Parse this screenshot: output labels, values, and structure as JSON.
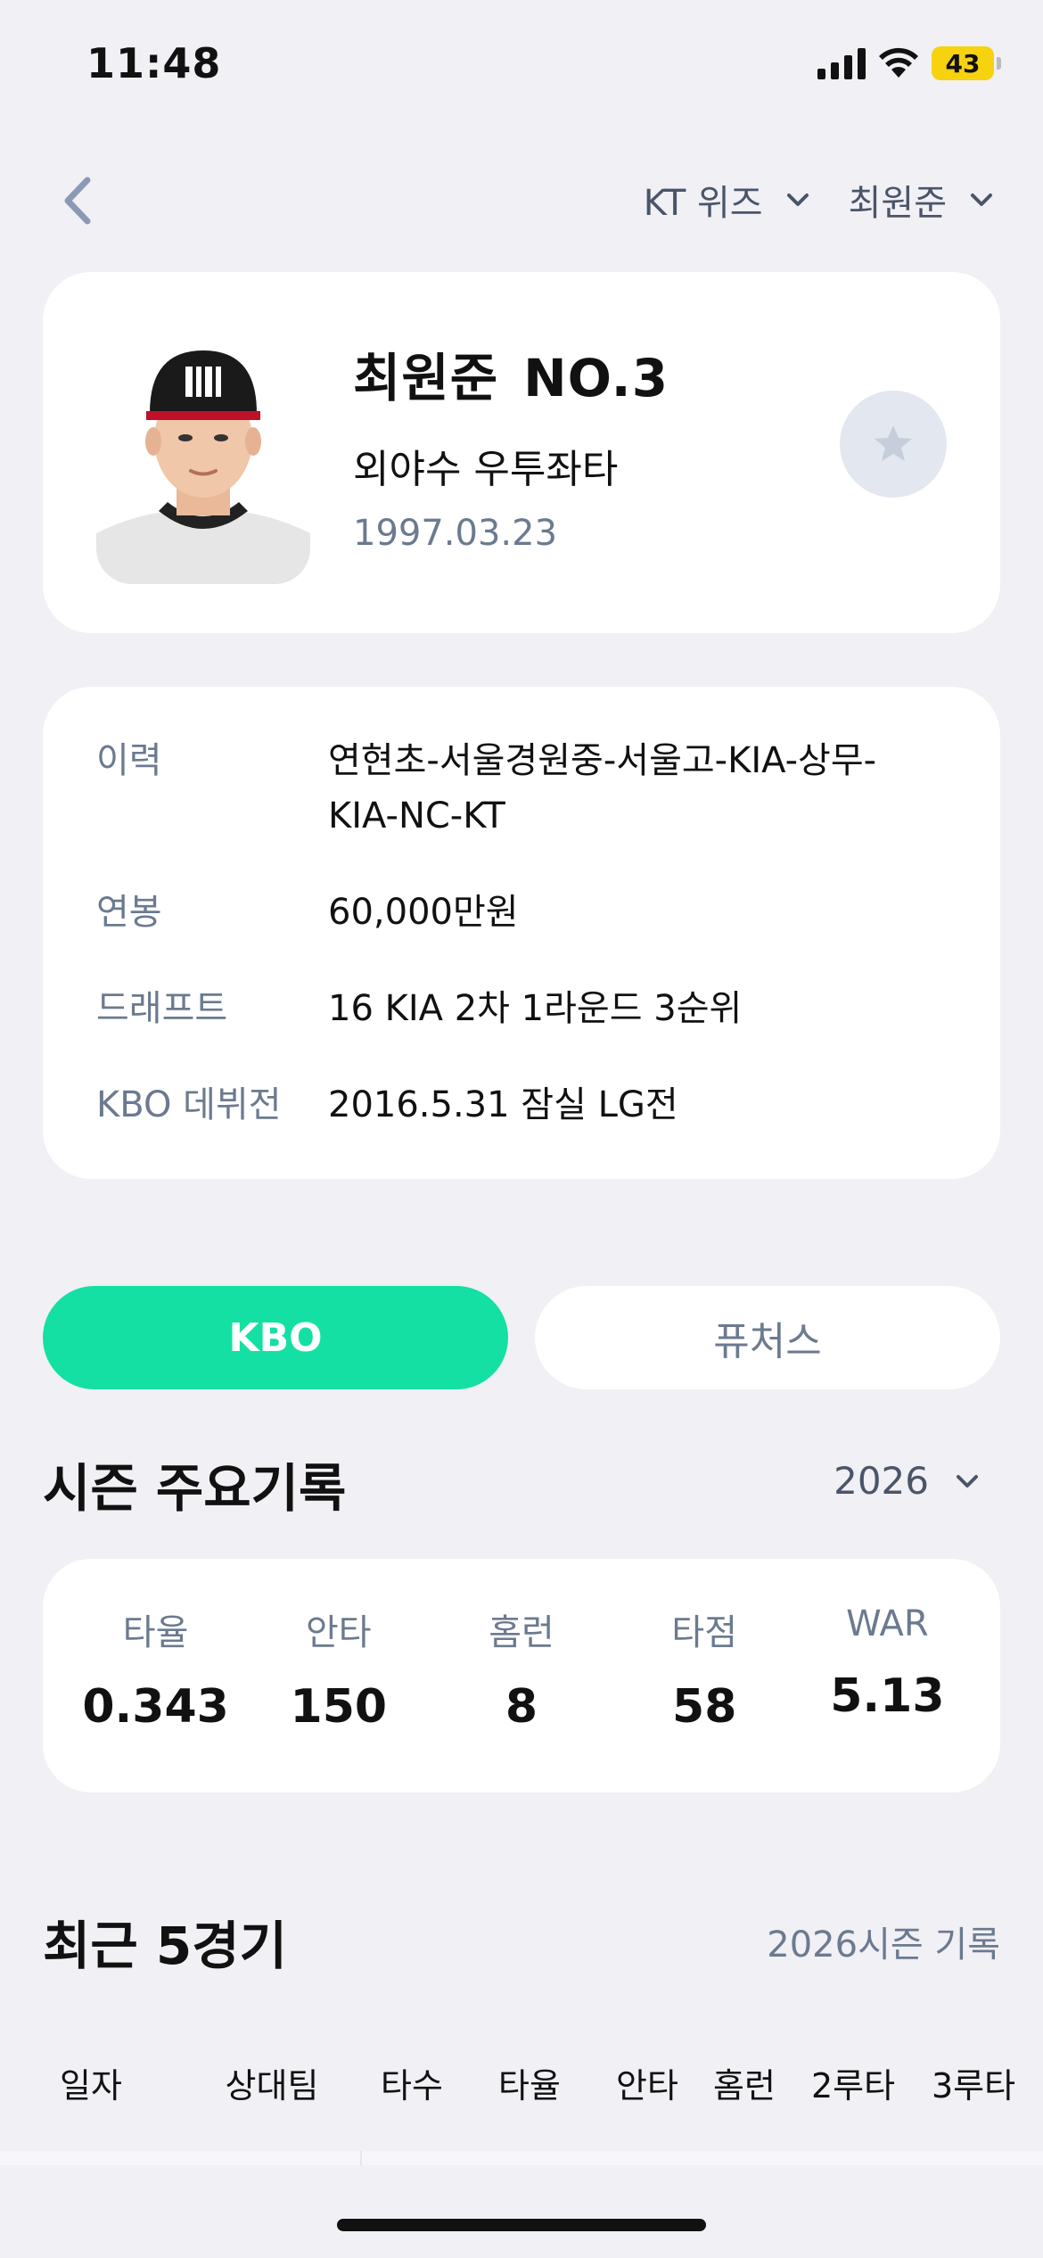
{
  "status_bar": {
    "time": "11:48",
    "battery": "43"
  },
  "nav": {
    "team_dropdown": "KT 위즈",
    "player_dropdown": "최원준"
  },
  "profile": {
    "name": "최원준",
    "number": "NO.3",
    "position": "외야수 우투좌타",
    "birth": "1997.03.23"
  },
  "info": {
    "rows": [
      {
        "label": "이력",
        "value_line1": "연현초-서울경원중-서울고-KIA-상무-",
        "value_line2": "KIA-NC-KT"
      },
      {
        "label": "연봉",
        "value": "60,000만원"
      },
      {
        "label": "드래프트",
        "value": "16 KIA 2차 1라운드 3순위"
      },
      {
        "label": "KBO 데뷔전",
        "value": "2016.5.31 잠실 LG전"
      }
    ]
  },
  "league_toggle": {
    "active": "KBO",
    "inactive": "퓨처스"
  },
  "season": {
    "title": "시즌 주요기록",
    "year": "2026",
    "stats": [
      {
        "label": "타율",
        "value": "0.343"
      },
      {
        "label": "안타",
        "value": "150"
      },
      {
        "label": "홈런",
        "value": "8"
      },
      {
        "label": "타점",
        "value": "58"
      },
      {
        "label": "WAR",
        "value": "5.13"
      }
    ]
  },
  "recent": {
    "title": "최근 5경기",
    "note": "2026시즌 기록",
    "columns": [
      "일자",
      "상대팀",
      "타수",
      "타율",
      "안타",
      "홈런",
      "2루타",
      "3루타"
    ]
  },
  "colors": {
    "accent": "#14e0a4",
    "background": "#f0f0f5",
    "muted_text": "#6b7a8f"
  }
}
